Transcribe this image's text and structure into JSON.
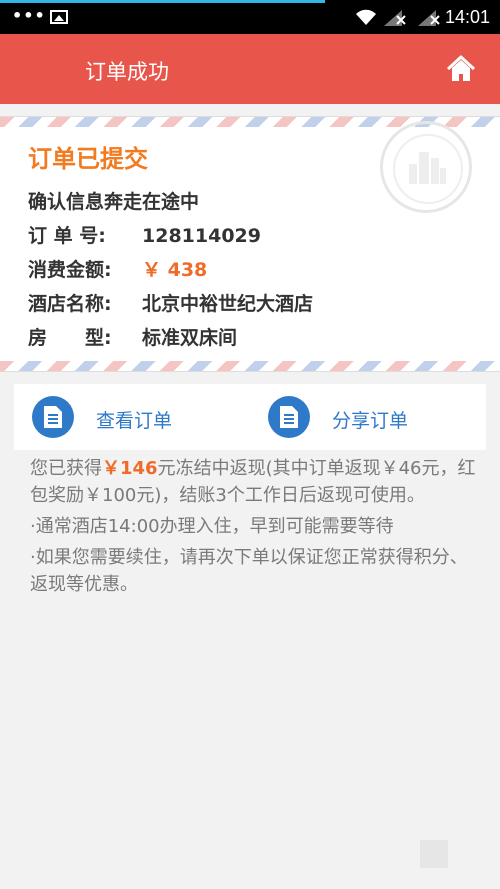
{
  "status_bar": {
    "time": "14:01",
    "icons": [
      "more-dots-icon",
      "image-icon",
      "wifi-icon",
      "signal-icon",
      "signal-icon"
    ]
  },
  "header": {
    "title": "订单成功",
    "home_icon": "home-icon"
  },
  "order_card": {
    "heading": "订单已提交",
    "status_line": "确认信息奔走在途中",
    "fields": [
      {
        "label": "订 单 号:",
        "value": "128114029"
      },
      {
        "label": "消费金额:",
        "value": "￥ 438"
      },
      {
        "label": "酒店名称:",
        "value": "北京中裕世纪大酒店"
      },
      {
        "label": "房　　型:",
        "value": "标准双床间"
      }
    ]
  },
  "actions": {
    "view_label": "查看订单",
    "share_label": "分享订单"
  },
  "info": {
    "cashback_prefix": "您已获得",
    "cashback_amount": "￥146",
    "cashback_suffix": "元冻结中返现(其中订单返现￥46元，红包奖励￥100元)，结账3个工作日后返现可使用。",
    "note1": "·通常酒店14:00办理入住，早到可能需要等待",
    "note2": "·如果您需要续住，请再次下单以保证您正常获得积分、返现等优惠。"
  },
  "colors": {
    "header_bg": "#e8554b",
    "heading_orange": "#f27a1f",
    "price_orange": "#f06b2a",
    "action_blue": "#2f79c9"
  }
}
